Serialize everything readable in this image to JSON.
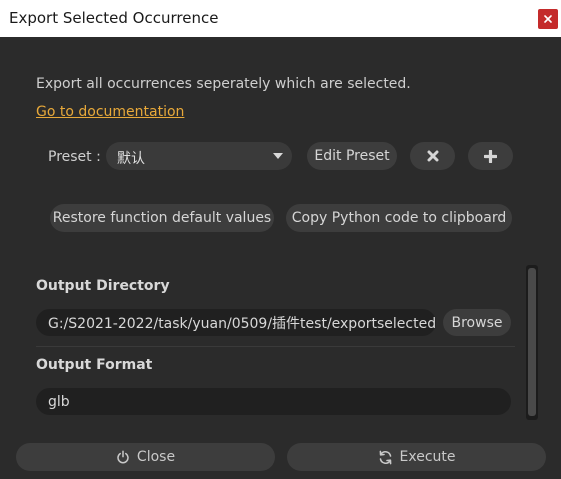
{
  "window": {
    "title": "Export Selected Occurrence"
  },
  "description": "Export all occurrences seperately which are selected.",
  "documentation_link": "Go to documentation",
  "preset": {
    "label": "Preset :",
    "value": "默认",
    "edit_label": "Edit Preset",
    "delete_icon": "x-icon",
    "add_icon": "plus-icon"
  },
  "actions": {
    "restore_label": "Restore function default values",
    "copy_python_label": "Copy Python code to clipboard"
  },
  "output_directory": {
    "title": "Output Directory",
    "value": "G:/S2021-2022/task/yuan/0509/插件test/exportselected",
    "browse_label": "Browse"
  },
  "output_format": {
    "title": "Output Format",
    "value": "glb"
  },
  "footer": {
    "close_label": "Close",
    "execute_label": "Execute"
  },
  "colors": {
    "background": "#2b2b2b",
    "link": "#e8a93a",
    "close_button": "#c42b2b"
  }
}
